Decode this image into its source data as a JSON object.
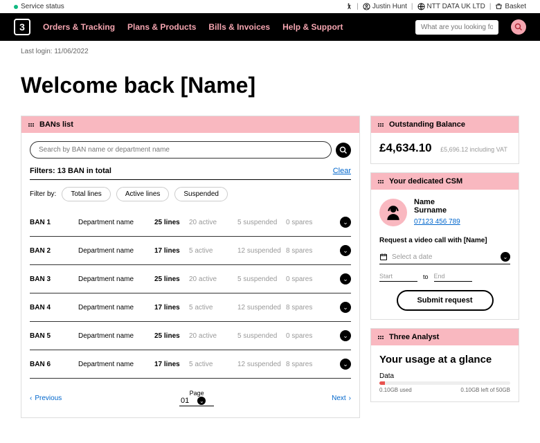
{
  "topbar": {
    "status": "Service status",
    "user": "Justin Hunt",
    "company": "NTT DATA UK LTD",
    "basket": "Basket"
  },
  "nav": {
    "links": [
      "Orders & Tracking",
      "Plans & Products",
      "Bills & Invoices",
      "Help & Support"
    ],
    "search_placeholder": "What are you looking for?"
  },
  "last_login": "Last login: 11/06/2022",
  "welcome": "Welcome back [Name]",
  "bans": {
    "title": "BANs list",
    "search_placeholder": "Search by BAN name or department name",
    "filters_label": "Filters: 13 BAN in total",
    "clear": "Clear",
    "filter_by": "Filter by:",
    "chips": [
      "Total lines",
      "Active lines",
      "Suspended"
    ],
    "rows": [
      {
        "name": "BAN 1",
        "dept": "Department name",
        "lines": "25 lines",
        "active": "20 active",
        "suspended": "5 suspended",
        "spares": "0 spares"
      },
      {
        "name": "BAN 2",
        "dept": "Department name",
        "lines": "17 lines",
        "active": "5 active",
        "suspended": "12 suspended",
        "spares": "8 spares"
      },
      {
        "name": "BAN 3",
        "dept": "Department name",
        "lines": "25 lines",
        "active": "20 active",
        "suspended": "5 suspended",
        "spares": "0 spares"
      },
      {
        "name": "BAN 4",
        "dept": "Department name",
        "lines": "17 lines",
        "active": "5 active",
        "suspended": "12 suspended",
        "spares": "8 spares"
      },
      {
        "name": "BAN 5",
        "dept": "Department name",
        "lines": "25 lines",
        "active": "20 active",
        "suspended": "5 suspended",
        "spares": "0 spares"
      },
      {
        "name": "BAN 6",
        "dept": "Department name",
        "lines": "17 lines",
        "active": "5 active",
        "suspended": "12 suspended",
        "spares": "8 spares"
      }
    ],
    "prev": "Previous",
    "next": "Next",
    "page_label": "Page",
    "page_val": "01"
  },
  "balance": {
    "title": "Outstanding Balance",
    "amount": "£4,634.10",
    "vat": "£5,696.12 including VAT"
  },
  "csm": {
    "title": "Your dedicated CSM",
    "name": "Name",
    "surname": "Surname",
    "phone": "07123 456 789",
    "request_label": "Request a video call with [Name]",
    "date_placeholder": "Select a date",
    "start": "Start",
    "to": "to",
    "end": "End",
    "submit": "Submit request"
  },
  "analyst": {
    "title": "Three Analyst",
    "usage_title": "Your usage at a glance",
    "data_label": "Data",
    "used": "0.10GB used",
    "left": "0.10GB left of 50GB"
  }
}
